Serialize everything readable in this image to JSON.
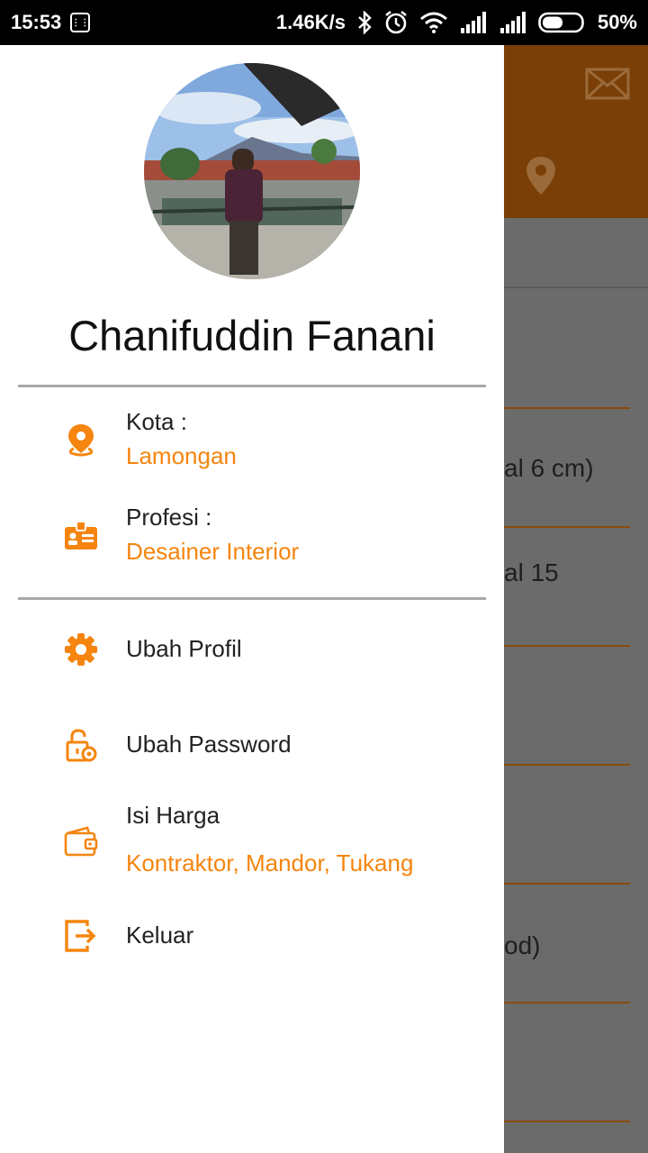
{
  "status_bar": {
    "time": "15:53",
    "speed": "1.46K/s",
    "battery": "50%"
  },
  "background": {
    "row_texts": [
      "al 6 cm)",
      "al 15",
      "od)"
    ]
  },
  "profile": {
    "name": "Chanifuddin Fanani"
  },
  "info": {
    "city_label": "Kota :",
    "city_value": "Lamongan",
    "job_label": "Profesi :",
    "job_value": "Desainer Interior"
  },
  "menu": {
    "edit_profile": "Ubah Profil",
    "change_password": "Ubah Password",
    "fill_price": "Isi Harga",
    "fill_price_sub": "Kontraktor, Mandor, Tukang",
    "logout": "Keluar"
  },
  "colors": {
    "accent": "#f5850f",
    "header_dim": "#7a3f06",
    "scrim": "#6b6b6b"
  },
  "icons": [
    "bbm-icon",
    "bluetooth-icon",
    "alarm-icon",
    "wifi-icon",
    "signal-icon",
    "battery-icon",
    "mail-icon",
    "location-pin-icon",
    "id-card-icon",
    "gear-icon",
    "lock-gear-icon",
    "wallet-icon",
    "logout-icon"
  ]
}
